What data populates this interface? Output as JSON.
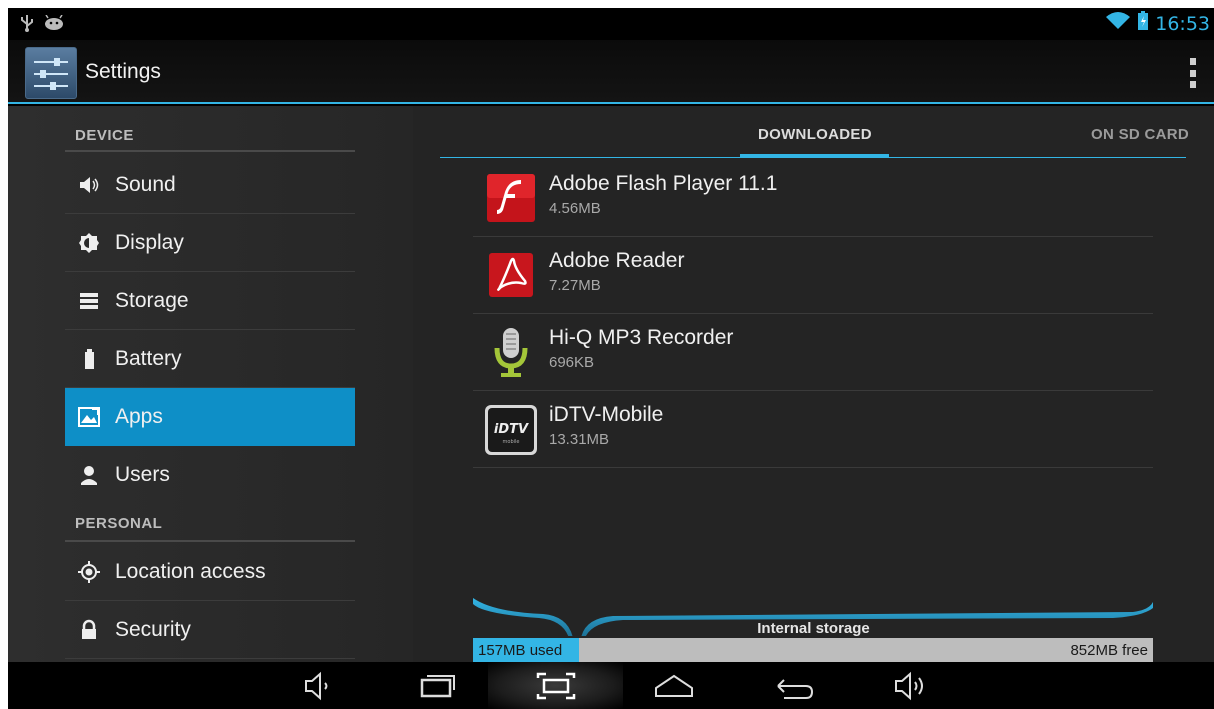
{
  "status_bar": {
    "left_icons": [
      "usb-icon",
      "android-debug-icon"
    ],
    "right_icons": [
      "wifi-icon",
      "battery-charging-icon"
    ],
    "time": "16:53"
  },
  "action_bar": {
    "title": "Settings",
    "icon": "settings-sliders-icon",
    "overflow_icon": "overflow-menu-icon"
  },
  "sidebar": {
    "sections": [
      {
        "label": "DEVICE"
      },
      {
        "label": "PERSONAL"
      }
    ],
    "items": [
      {
        "label": "Sound",
        "icon": "speaker-icon",
        "selected": false
      },
      {
        "label": "Display",
        "icon": "brightness-icon",
        "selected": false
      },
      {
        "label": "Storage",
        "icon": "storage-icon",
        "selected": false
      },
      {
        "label": "Battery",
        "icon": "battery-icon",
        "selected": false
      },
      {
        "label": "Apps",
        "icon": "apps-icon",
        "selected": true
      },
      {
        "label": "Users",
        "icon": "user-icon",
        "selected": false
      },
      {
        "label": "Location access",
        "icon": "location-icon",
        "selected": false
      },
      {
        "label": "Security",
        "icon": "lock-icon",
        "selected": false
      }
    ]
  },
  "tabs": [
    {
      "label": "DOWNLOADED",
      "selected": true
    },
    {
      "label": "ON SD CARD",
      "selected": false
    }
  ],
  "apps": [
    {
      "name": "Adobe Flash Player 11.1",
      "size": "4.56MB",
      "icon": "flash-player-icon"
    },
    {
      "name": "Adobe Reader",
      "size": "7.27MB",
      "icon": "adobe-reader-icon"
    },
    {
      "name": "Hi-Q MP3 Recorder",
      "size": "696KB",
      "icon": "microphone-icon"
    },
    {
      "name": "iDTV-Mobile",
      "size": "13.31MB",
      "icon": "idtv-icon"
    }
  ],
  "storage": {
    "label": "Internal storage",
    "used": "157MB used",
    "free": "852MB free",
    "used_fraction": 0.156
  },
  "nav_bar": {
    "buttons": [
      "volume-down-icon",
      "recent-apps-icon",
      "screenshot-icon",
      "home-icon",
      "back-icon",
      "volume-up-icon"
    ]
  },
  "colors": {
    "accent": "#33b5e5",
    "selected_item": "#0e8fc7"
  }
}
